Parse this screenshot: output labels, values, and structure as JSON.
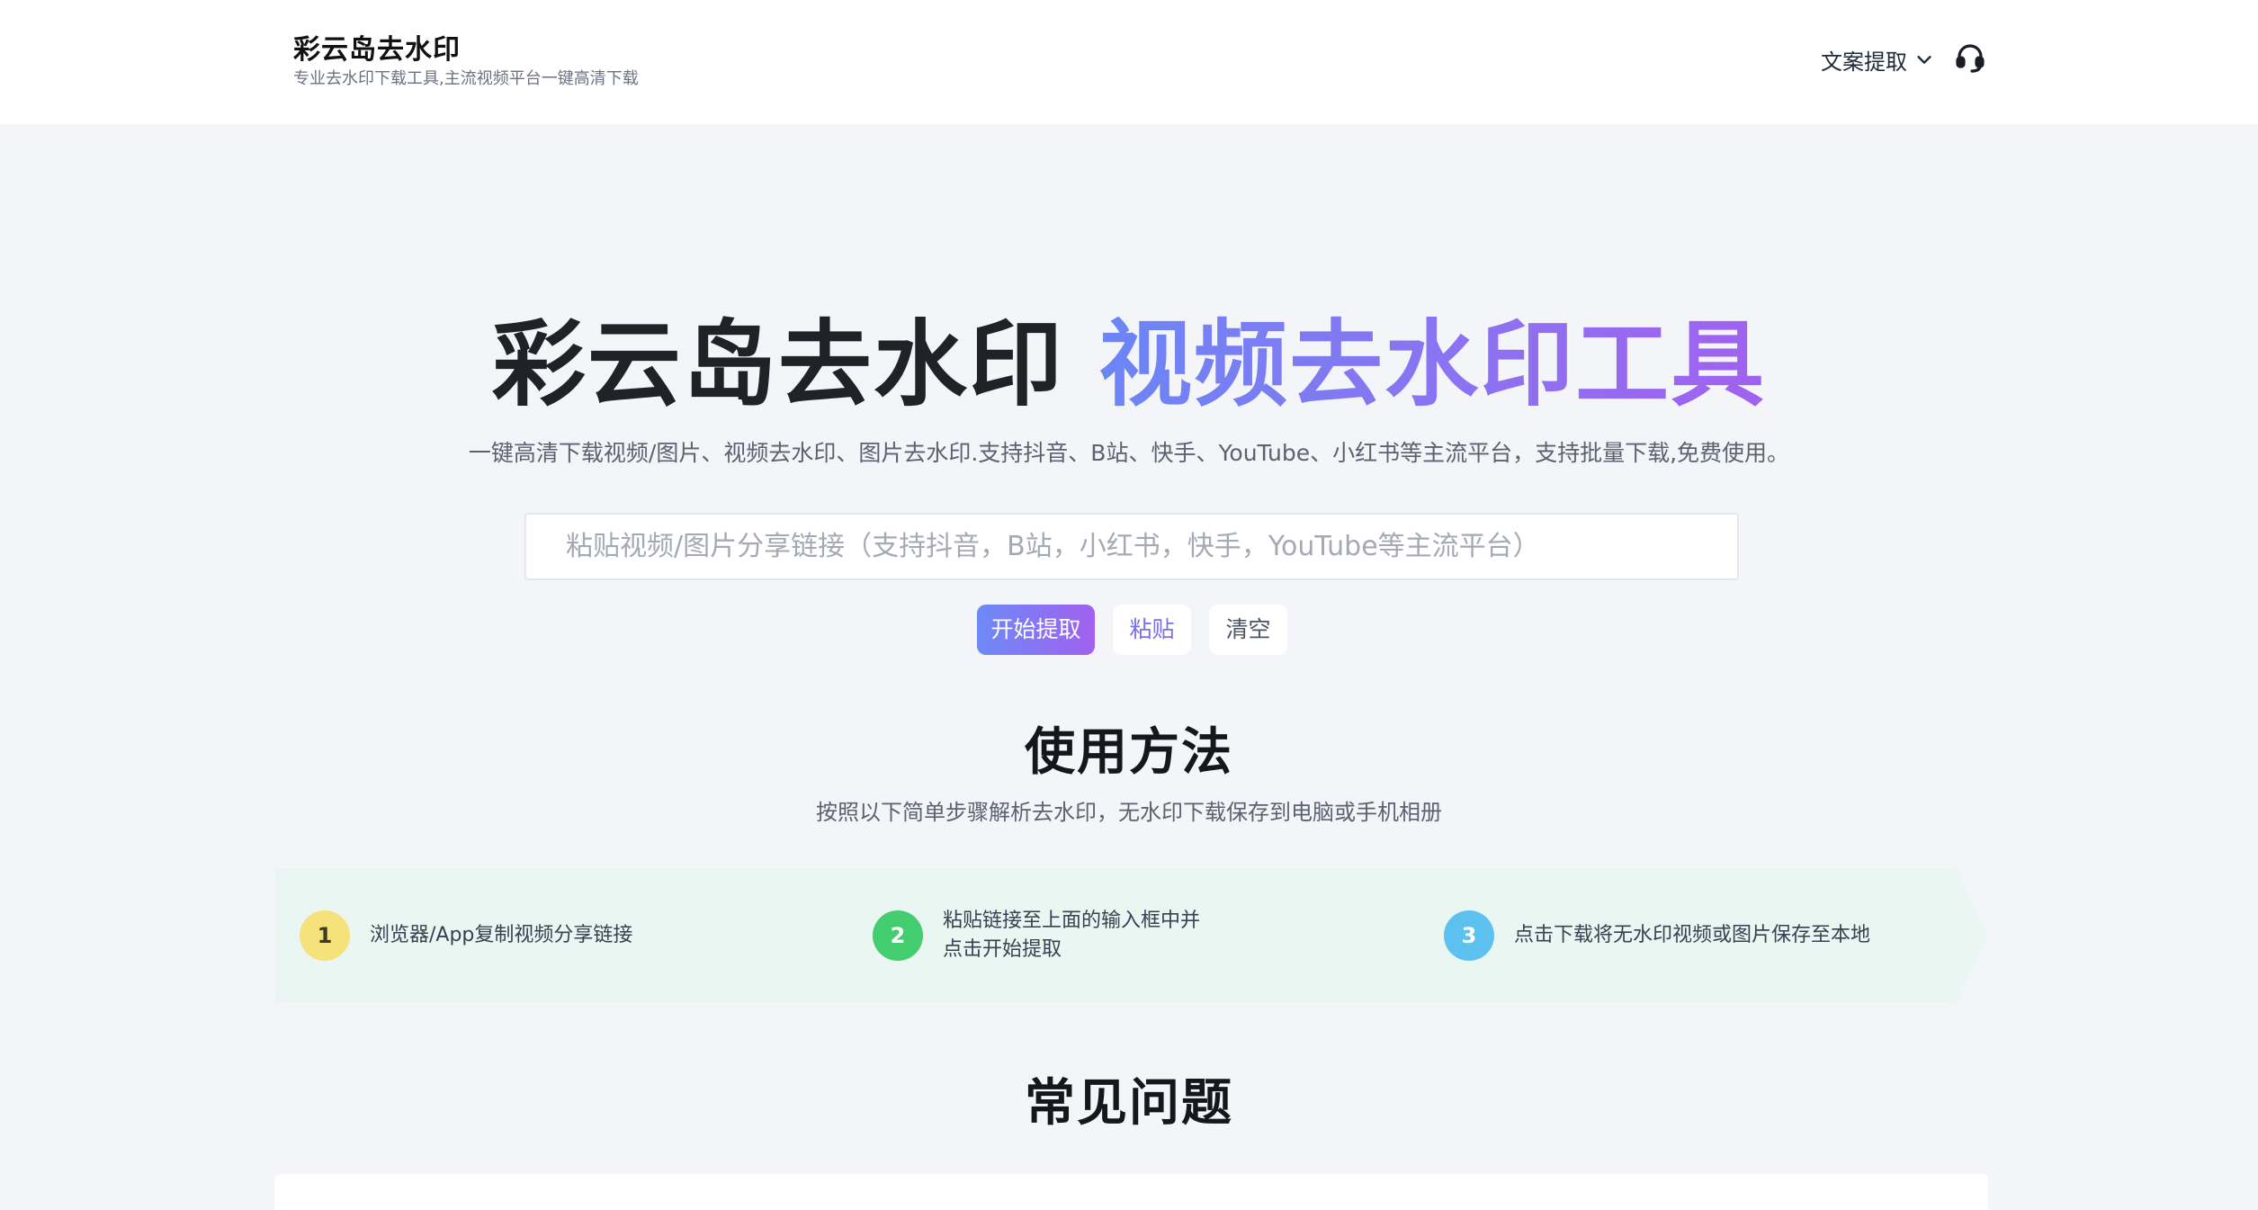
{
  "header": {
    "brand_title": "彩云岛去水印",
    "brand_subtitle": "专业去水印下载工具,主流视频平台一键高清下载",
    "nav_menu_label": "文案提取",
    "nav_menu_icon": "chevron-down-icon",
    "support_icon": "headset-icon"
  },
  "hero": {
    "title_main": "彩云岛去水印",
    "title_accent": "视频去水印工具",
    "description": "一键高清下载视频/图片、视频去水印、图片去水印.支持抖音、B站、快手、YouTube、小红书等主流平台，支持批量下载,免费使用。",
    "input_value": "",
    "input_placeholder": "粘贴视频/图片分享链接（支持抖音，B站，小红书，快手，YouTube等主流平台）",
    "start_button": "开始提取",
    "paste_button": "粘贴",
    "clear_button": "清空"
  },
  "usage": {
    "title": "使用方法",
    "subtitle": "按照以下简单步骤解析去水印，无水印下载保存到电脑或手机相册",
    "steps": [
      {
        "number": "1",
        "line1": "浏览器/App复制视频分享链接",
        "line2": ""
      },
      {
        "number": "2",
        "line1": "粘贴链接至上面的输入框中并",
        "line2": "点击开始提取"
      },
      {
        "number": "3",
        "line1": "点击下载将无水印视频或图片保存至本地",
        "line2": ""
      }
    ]
  },
  "faq": {
    "title": "常见问题"
  },
  "colors": {
    "accent_start": "#6b86f5",
    "accent_end": "#a062ef",
    "step1": "#f6e27a",
    "step2": "#44cd6f",
    "step3": "#5cc1ef",
    "steps_bg": "#eaf6f1"
  }
}
